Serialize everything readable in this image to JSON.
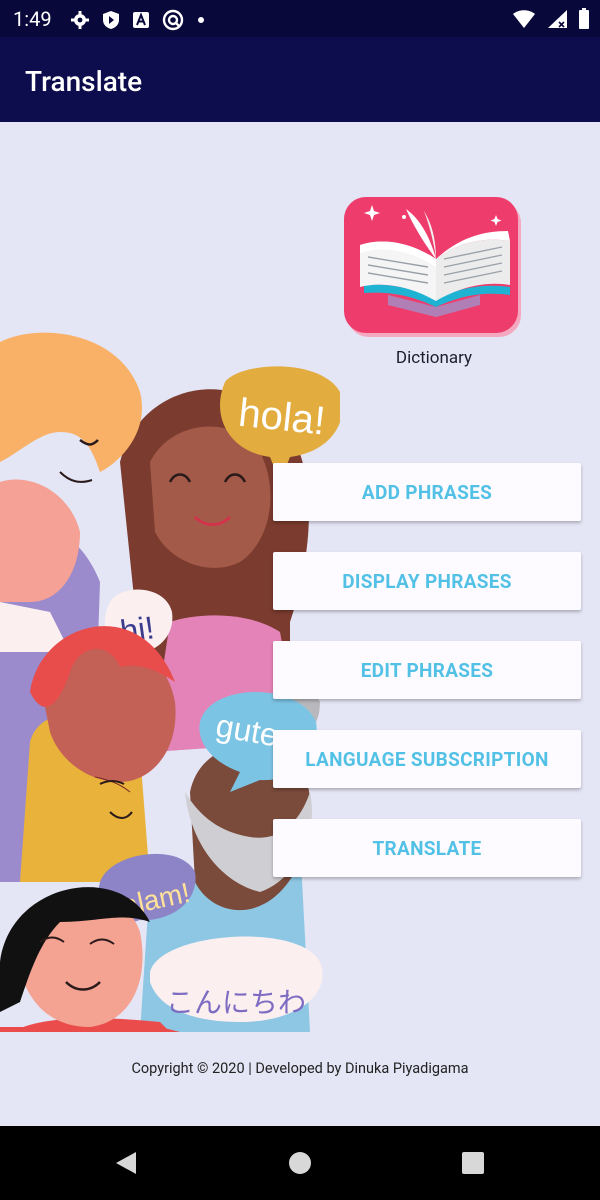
{
  "status_bar": {
    "time": "1:49",
    "left_icons": [
      "gear-icon",
      "shield-play-icon",
      "text-a-icon",
      "circle-q-icon",
      "dot-icon"
    ],
    "right_icons": [
      "wifi-icon",
      "cell-signal-icon",
      "battery-icon"
    ]
  },
  "app_bar": {
    "title": "Translate"
  },
  "dictionary": {
    "label": "Dictionary",
    "icon": "open-book-icon",
    "tile_color": "#ee3d6c"
  },
  "illustration": {
    "speech_bubbles": [
      "hola!",
      "hi!",
      "guten tag!",
      "salam!",
      "こんにちわ"
    ]
  },
  "buttons": {
    "add_phrases": "ADD PHRASES",
    "display_phrases": "DISPLAY PHRASES",
    "edit_phrases": "EDIT PHRASES",
    "language_subscription": "LANGUAGE SUBSCRIPTION",
    "translate": "TRANSLATE"
  },
  "footer": {
    "copyright": "Copyright © 2020 | Developed by Dinuka Piyadigama"
  },
  "nav_bar": {
    "icons": [
      "back-icon",
      "home-icon",
      "recents-icon"
    ]
  },
  "colors": {
    "status_bar": "#08083a",
    "app_bar": "#0d0d4d",
    "background": "#e4e5f5",
    "button_text": "#53c1e5",
    "button_bg": "#fdfbff"
  }
}
